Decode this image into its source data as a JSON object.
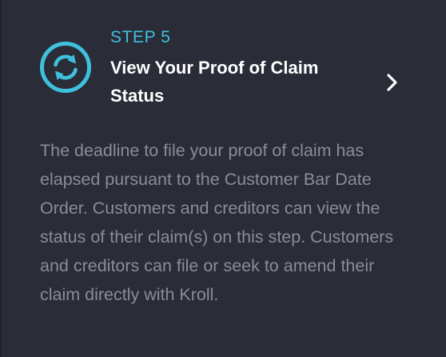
{
  "step": {
    "label": "STEP 5",
    "title": "View Your Proof of Claim Status",
    "icon": "refresh-icon",
    "action_icon": "chevron-right-icon",
    "description": "The deadline to file your proof of claim has elapsed pursuant to the Customer Bar Date Order. Customers and creditors can view the status of their claim(s) on this step. Customers and creditors can file or seek to amend their claim directly with Kroll."
  },
  "colors": {
    "background": "#2a2c37",
    "accent": "#3fc1de",
    "title": "#ffffff",
    "body_text": "#8b8c95"
  }
}
